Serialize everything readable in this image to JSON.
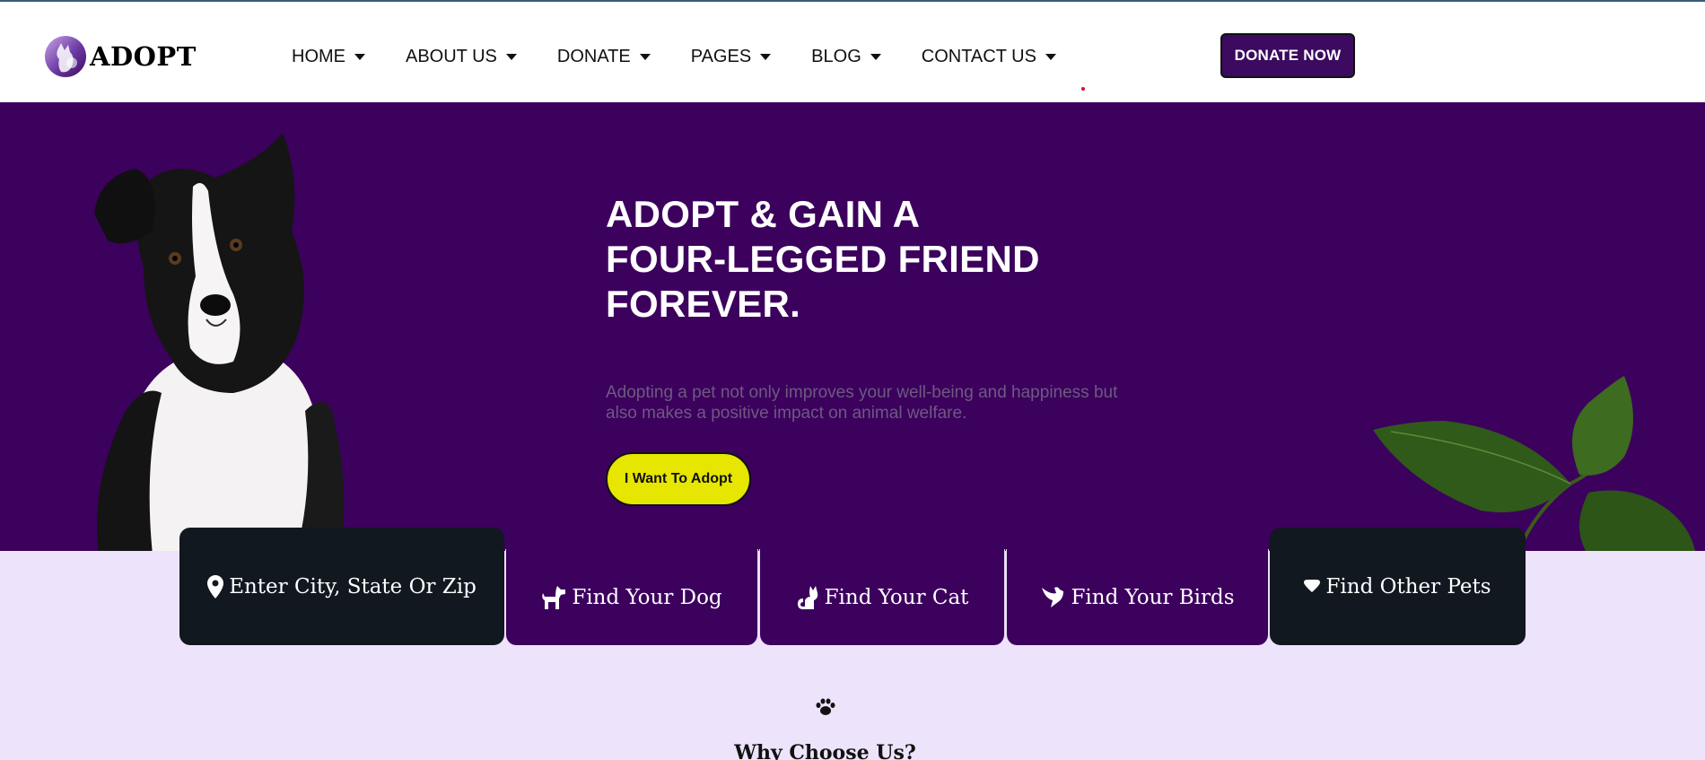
{
  "brand": {
    "name": "ADOPT",
    "logo_icon": "adopt-logo-icon"
  },
  "nav": {
    "items": [
      {
        "label": "HOME"
      },
      {
        "label": "ABOUT US"
      },
      {
        "label": "DONATE"
      },
      {
        "label": "PAGES"
      },
      {
        "label": "BLOG"
      },
      {
        "label": "CONTACT US"
      }
    ],
    "cta": "DONATE NOW"
  },
  "hero": {
    "title_lines": [
      "ADOPT & GAIN A",
      "FOUR-LEGGED FRIEND",
      "FOREVER."
    ],
    "subtitle": "Adopting a pet not only improves your well-being and happiness but also makes a positive impact on animal welfare.",
    "button": "I Want To Adopt"
  },
  "search": {
    "items": [
      {
        "label": "Enter City, State Or Zip",
        "icon": "map-pin-icon"
      },
      {
        "label": "Find Your Dog",
        "icon": "dog-icon"
      },
      {
        "label": "Find Your Cat",
        "icon": "cat-icon"
      },
      {
        "label": "Find Your Birds",
        "icon": "bird-icon"
      },
      {
        "label": "Find Other Pets",
        "icon": "heart-icon"
      }
    ]
  },
  "why": {
    "icon": "paw-icon",
    "title": "Why Choose Us?"
  },
  "colors": {
    "primary": "#3c005d",
    "accent": "#e6e600",
    "dark": "#111820",
    "background": "#ede3fb"
  }
}
